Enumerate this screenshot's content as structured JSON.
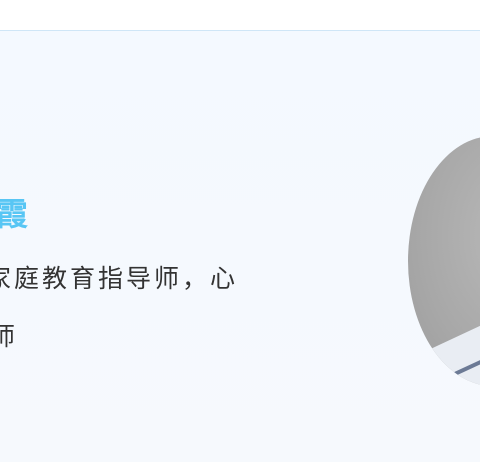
{
  "profile": {
    "name_visible": "霞",
    "description_line_1": "家庭教育指导师，心",
    "description_line_2": "师"
  },
  "colors": {
    "name": "#58c6f4",
    "text": "#333333",
    "card_border": "#cfe6f7",
    "card_background": "#f4f9ff"
  }
}
